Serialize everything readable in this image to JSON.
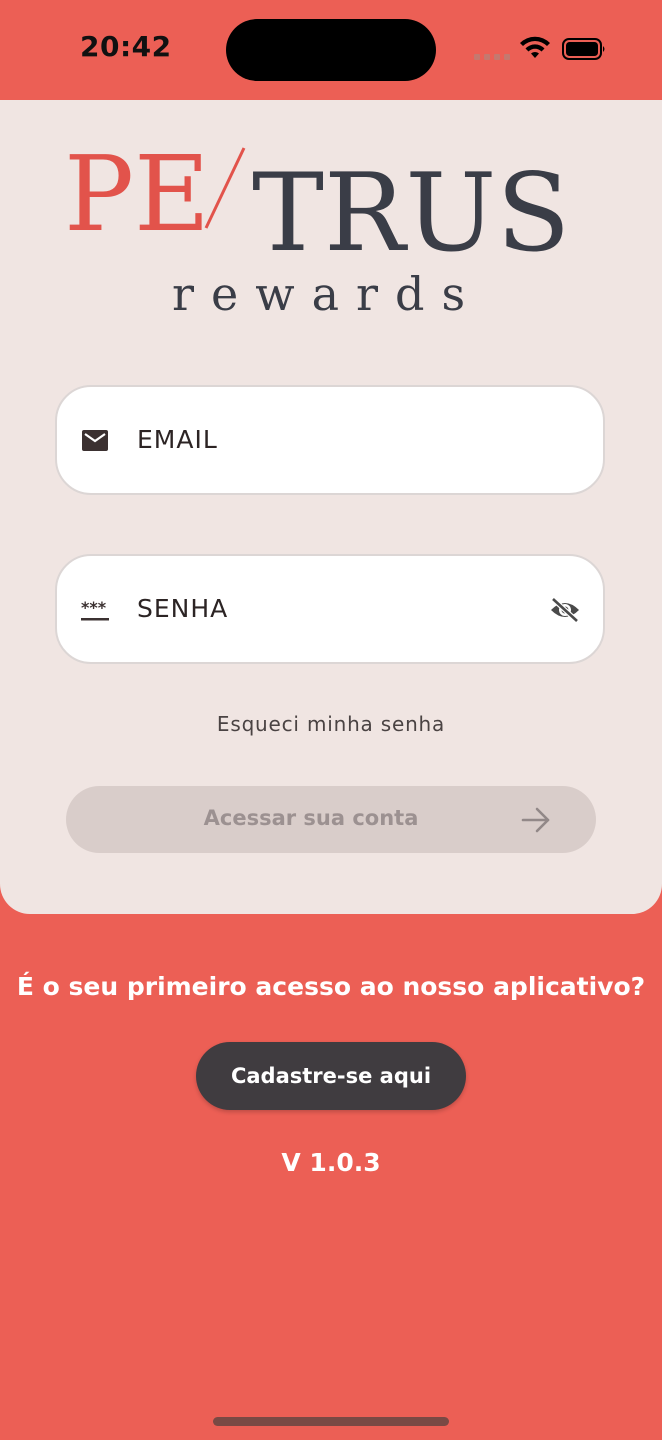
{
  "status_bar": {
    "time": "20:42"
  },
  "logo": {
    "part1": "PE",
    "part2": "TRUS",
    "tagline": "rewards",
    "accent_color": "#e2534b",
    "dark_color": "#3a3d47"
  },
  "login_form": {
    "email_placeholder": "EMAIL",
    "password_placeholder": "SENHA",
    "forgot_password": "Esqueci minha senha",
    "submit_label": "Acessar sua conta"
  },
  "signup": {
    "prompt": "É o seu primeiro acesso ao nosso aplicativo?",
    "button_label": "Cadastre-se aqui"
  },
  "version": "V 1.0.3",
  "colors": {
    "background": "#ec5f55",
    "card": "#f0e5e2",
    "button_disabled": "#d9cdca",
    "button_dark": "#403c40"
  },
  "icons": {
    "email": "mail-icon",
    "password": "password-dots-icon",
    "visibility": "eye-off-icon",
    "submit": "arrow-right-icon"
  }
}
